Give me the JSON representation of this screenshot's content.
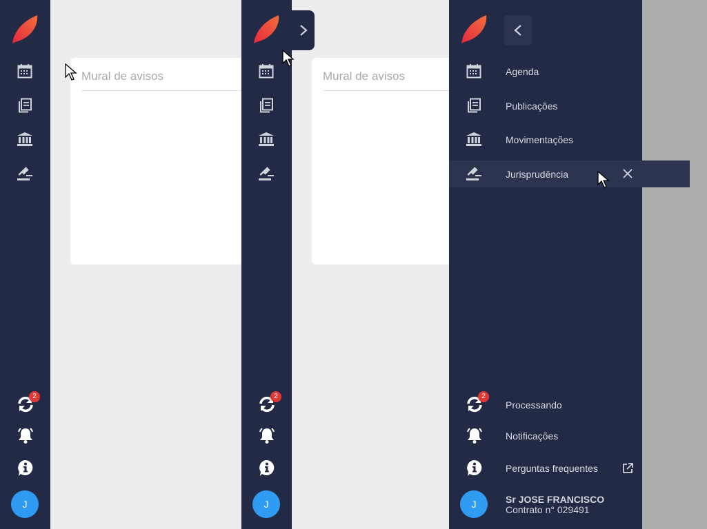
{
  "notice_board": {
    "title": "Mural de avisos"
  },
  "nav": {
    "items": [
      {
        "label": "Agenda",
        "icon": "calendar-icon"
      },
      {
        "label": "Publicações",
        "icon": "publications-icon"
      },
      {
        "label": "Movimentações",
        "icon": "bank-icon"
      },
      {
        "label": "Jurisprudência",
        "icon": "gavel-icon"
      }
    ],
    "bottom": [
      {
        "label": "Processando",
        "icon": "sync-icon",
        "badge": "2"
      },
      {
        "label": "Notificações",
        "icon": "bell-icon"
      },
      {
        "label": "Perguntas frequentes",
        "icon": "info-icon"
      }
    ]
  },
  "user": {
    "initial": "J",
    "name": "Sr JOSE FRANCISCO",
    "contract": "Contrato n° 029491"
  },
  "colors": {
    "sidebar": "#232a45",
    "accent": "#e33b3b",
    "avatar": "#2f9bf2",
    "badge": "#e13838"
  }
}
